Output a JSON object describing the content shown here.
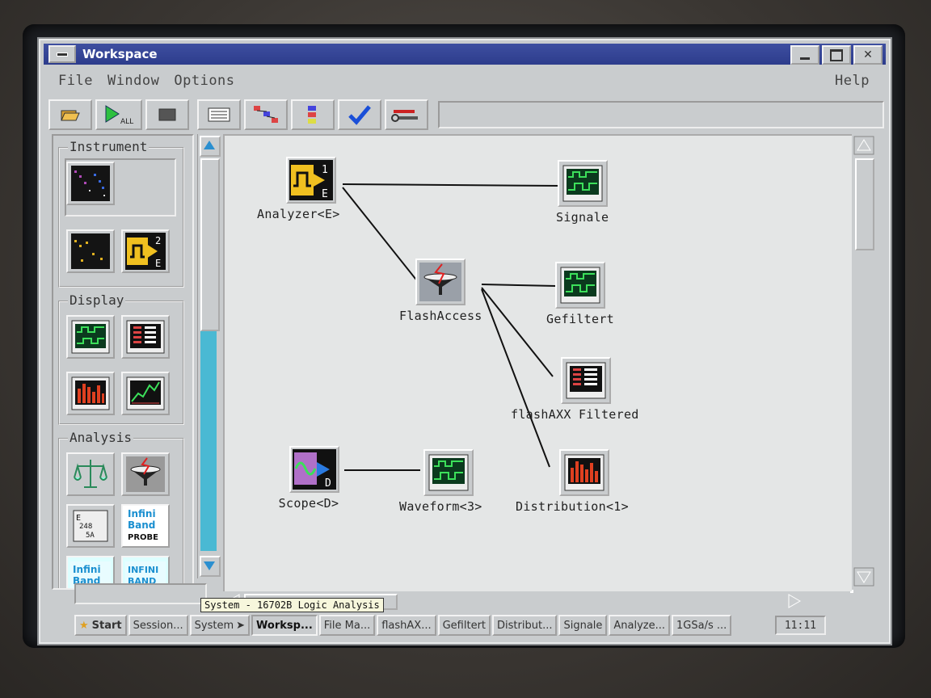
{
  "window": {
    "title": "Workspace"
  },
  "menubar": {
    "items": [
      "File",
      "Window",
      "Options"
    ],
    "help": "Help"
  },
  "toolbar": {
    "buttons": [
      {
        "name": "open",
        "icon": "folder-open-icon"
      },
      {
        "name": "run-all",
        "icon": "play-all-icon",
        "label": "ALL"
      },
      {
        "name": "stop",
        "icon": "stop-icon"
      },
      {
        "name": "list",
        "icon": "list-icon"
      },
      {
        "name": "hierarchy",
        "icon": "tree-icon"
      },
      {
        "name": "layout",
        "icon": "layout-icon"
      },
      {
        "name": "check",
        "icon": "checkmark-icon"
      },
      {
        "name": "settings",
        "icon": "tools-icon"
      }
    ],
    "status_text": ""
  },
  "sidebar": {
    "groups": [
      {
        "label": "Instrument"
      },
      {
        "label": "Display"
      },
      {
        "label": "Analysis"
      }
    ],
    "instrument_badge": {
      "number": "2",
      "letter": "E"
    },
    "analysis_icons": {
      "eye_chart_text": "E\n2 4 8\n5 A",
      "infiniband_probe": [
        "Infini",
        "Band",
        "PROBE"
      ],
      "infiniband_2": [
        "Infini",
        "Band"
      ],
      "infiniband_3": [
        "INFINI",
        "BAND"
      ]
    }
  },
  "canvas": {
    "nodes": [
      {
        "id": "analyzer",
        "label": "Analyzer<E>",
        "icon": "analyzer-icon",
        "badge_number": "1",
        "badge_letter": "E"
      },
      {
        "id": "signale",
        "label": "Signale",
        "icon": "waveform-display-icon"
      },
      {
        "id": "flashaccess",
        "label": "FlashAccess",
        "icon": "filter-funnel-icon"
      },
      {
        "id": "gefiltert",
        "label": "Gefiltert",
        "icon": "waveform-display-icon"
      },
      {
        "id": "flashaxx",
        "label": "flashAXX Filtered",
        "icon": "listing-display-icon"
      },
      {
        "id": "distribution",
        "label": "Distribution<1>",
        "icon": "histogram-display-icon"
      },
      {
        "id": "scope",
        "label": "Scope<D>",
        "icon": "scope-icon",
        "badge_letter": "D"
      },
      {
        "id": "waveform",
        "label": "Waveform<3>",
        "icon": "waveform-display-icon"
      }
    ]
  },
  "tooltip": "System - 16702B Logic Analysis",
  "taskbar": {
    "start": "Start",
    "tasks": [
      {
        "label": "Session...",
        "active": false
      },
      {
        "label": "System",
        "active": false
      },
      {
        "label": "Worksp...",
        "active": true
      },
      {
        "label": "File Ma...",
        "active": false
      },
      {
        "label": "flashAX...",
        "active": false
      },
      {
        "label": "Gefiltert",
        "active": false
      },
      {
        "label": "Distribut...",
        "active": false
      },
      {
        "label": "Signale",
        "active": false
      },
      {
        "label": "Analyze...",
        "active": false
      },
      {
        "label": "1GSa/s ...",
        "active": false
      }
    ],
    "clock": "11:11"
  },
  "colors": {
    "titlebar": "#2d3c8c",
    "panel": "#c9ccce",
    "canvas": "#e4e6e6",
    "scroll_fill": "#4ab9d3",
    "display_bg": "#0b3a1e",
    "trace": "#3ce05a"
  }
}
